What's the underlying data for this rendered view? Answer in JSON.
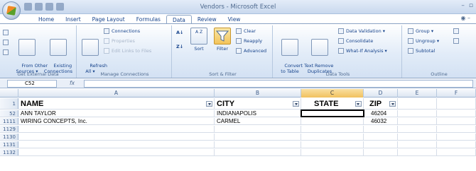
{
  "window": {
    "title": "Vendors - Microsoft Excel"
  },
  "tabs": [
    "Home",
    "Insert",
    "Page Layout",
    "Formulas",
    "Data",
    "Review",
    "View"
  ],
  "active_tab": "Data",
  "ribbon": {
    "get_external": {
      "from_other": "From Other\nSources ▾",
      "existing": "Existing\nConnections",
      "label": "Get External Data"
    },
    "manage": {
      "refresh": "Refresh\nAll ▾",
      "connections": "Connections",
      "properties": "Properties",
      "edit_links": "Edit Links to Files",
      "label": "Manage Connections"
    },
    "sort": {
      "sort": "Sort",
      "filter": "Filter",
      "clear": "Clear",
      "reapply": "Reapply",
      "advanced": "Advanced",
      "label": "Sort & Filter"
    },
    "tools": {
      "convert": "Convert Text\nto Table",
      "remove": "Remove\nDuplicates",
      "validation": "Data Validation ▾",
      "consolidate": "Consolidate",
      "whatif": "What-If Analysis ▾",
      "label": "Data Tools"
    },
    "outline": {
      "group": "Group ▾",
      "ungroup": "Ungroup ▾",
      "subtotal": "Subtotal",
      "label": "Outline"
    }
  },
  "formula_bar": {
    "name_box": "C52",
    "fx": "fx",
    "value": ""
  },
  "columns": [
    "A",
    "B",
    "C",
    "D",
    "E",
    "F"
  ],
  "header_row": {
    "row_num": "1",
    "a": "NAME",
    "b": "CITY",
    "c": "STATE",
    "d": "ZIP"
  },
  "rows": [
    {
      "row_num": "52",
      "a": "ANN TAYLOR",
      "b": "INDIANAPOLIS",
      "c": "",
      "d": "46204"
    },
    {
      "row_num": "1111",
      "a": "WIRING CONCEPTS, Inc.",
      "b": "CARMEL",
      "c": "",
      "d": "46032"
    },
    {
      "row_num": "1129",
      "a": "",
      "b": "",
      "c": "",
      "d": ""
    },
    {
      "row_num": "1130",
      "a": "",
      "b": "",
      "c": "",
      "d": ""
    },
    {
      "row_num": "1131",
      "a": "",
      "b": "",
      "c": "",
      "d": ""
    },
    {
      "row_num": "1132",
      "a": "",
      "b": "",
      "c": "",
      "d": ""
    }
  ]
}
